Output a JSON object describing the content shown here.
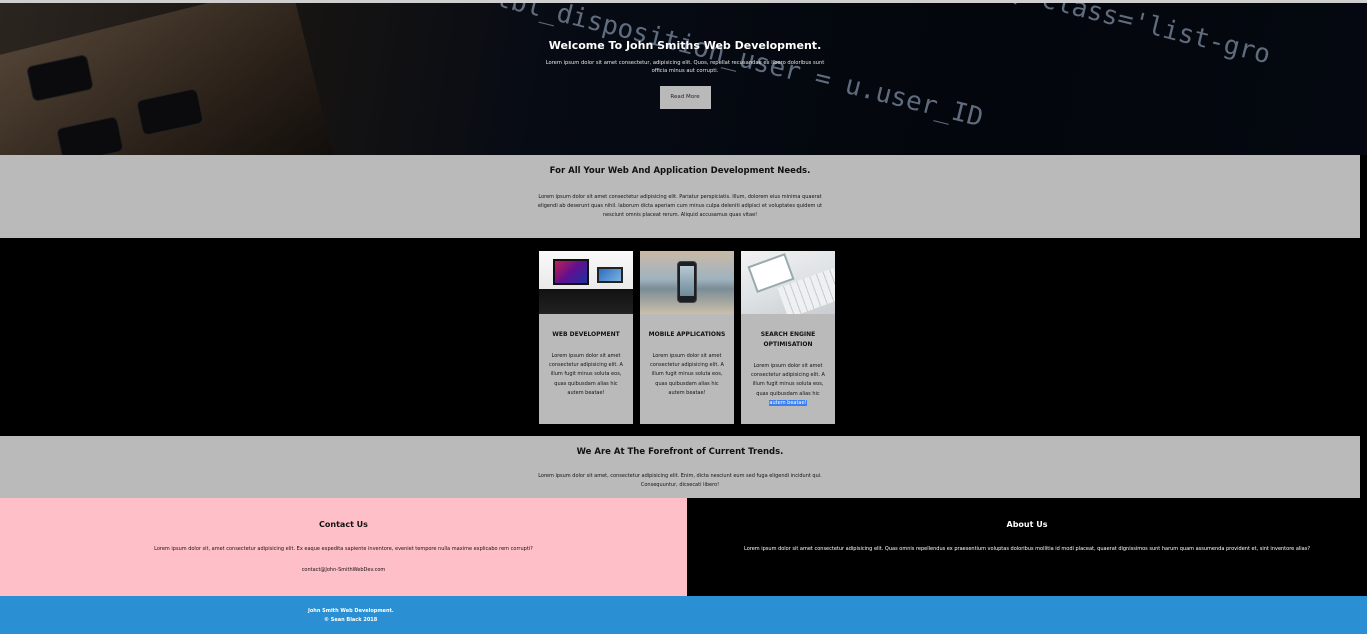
{
  "hero": {
    "title": "Welcome To John Smiths Web Development.",
    "text": "Lorem ipsum dolor sit amet consectetur, adipisicing elit. Quos, repellat recusandae ex libero doloribus sunt officia minus aut corrupti.",
    "button": "Read More",
    "code_line_1": "tbl_disposition_user = u.user_ID",
    "code_line_2": "\", class='list-gro"
  },
  "intro": {
    "title": "For All Your Web And Application Development Needs.",
    "text": "Lorem ipsum dolor sit amet consectetur adipisicing elit. Pariatur perspiciatis. Illum, dolorem eius minima quaerat eligendi ab deserunt quas nihil. laborum dicta aperiam cum minus culpa deleniti adipisci et voluptates quidem ut nesciunt omnis placeat rerum. Aliquid accusamus quas vitae!"
  },
  "services": [
    {
      "title": "WEB DEVELOPMENT",
      "text": "Lorem ipsum dolor sit amet consectetur adipisicing elit. A illum fugit minus soluta eos, quas quibusdam alias hic autem beatae!"
    },
    {
      "title": "MOBILE APPLICATIONS",
      "text": "Lorem ipsum dolor sit amet consectetur adipisicing elit. A illum fugit minus soluta eos, quas quibusdam alias hic autem beatae!"
    },
    {
      "title": "SEARCH ENGINE OPTIMISATION",
      "text": "Lorem ipsum dolor sit amet consectetur adipisicing elit. A illum fugit minus soluta eos, quas quibusdam alias hic",
      "highlighted": "autem beatae!"
    }
  ],
  "trends": {
    "title": "We Are At The Forefront of Current Trends.",
    "text": "Lorem ipsum dolor sit amet, consectetur adipisicing elit. Enim, dicta nesciunt eum sed fuga eligendi incidunt qui. Consequuntur, dicsecati libero!"
  },
  "contact": {
    "title": "Contact Us",
    "text": "Lorem ipsum dolor sit, amet consectetur adipisicing elit. Ex eaque expedita sapiente inventore, eveniet tempore nulla maxime explicabo rem corrupti?",
    "email": "contact@John-SmithWebDev.com"
  },
  "about": {
    "title": "About Us",
    "text": "Lorem ipsum dolor sit amet consectetur adipisicing elit. Quas omnis repellendus ex praesentium voluptas doloribus mollitia id modi placeat, quaerat dignissimos sunt harum quam assumenda provident et, sint inventore alias?"
  },
  "footer": {
    "line1": "John Smith Web Development.",
    "line2": "© Sean Black 2018"
  },
  "colors": {
    "grey_band": "#bababa",
    "contact_bg": "#ffbfc8",
    "footer_bg": "#2a8fd3"
  }
}
